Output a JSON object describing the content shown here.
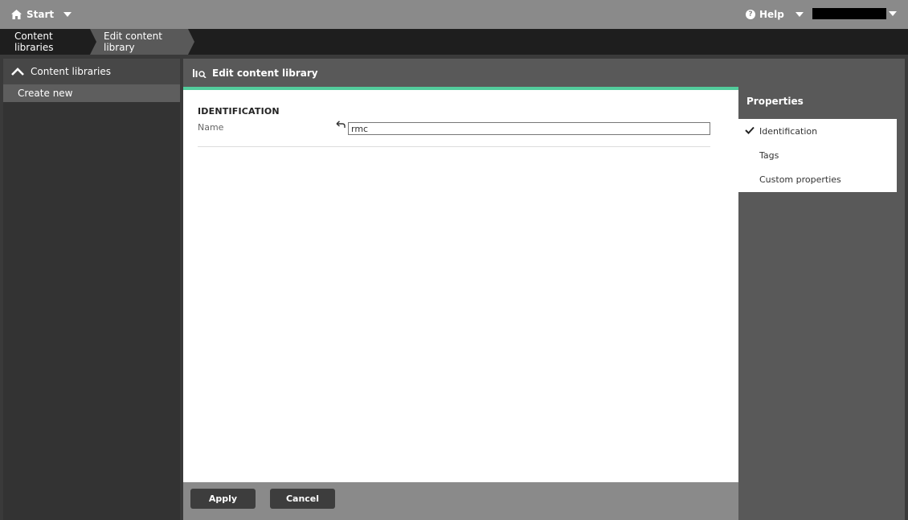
{
  "topbar": {
    "start_label": "Start",
    "help_label": "Help"
  },
  "breadcrumb": {
    "items": [
      "Content libraries",
      "Edit content library"
    ]
  },
  "sidebar": {
    "header_label": "Content libraries",
    "items": [
      {
        "label": "Create new"
      }
    ]
  },
  "main": {
    "title": "Edit content library",
    "section_title": "IDENTIFICATION",
    "name_label": "Name",
    "name_value": "rmc",
    "apply_label": "Apply",
    "cancel_label": "Cancel"
  },
  "properties": {
    "title": "Properties",
    "items": [
      {
        "label": "Identification",
        "checked": true
      },
      {
        "label": "Tags",
        "checked": false
      },
      {
        "label": "Custom properties",
        "checked": false
      }
    ]
  },
  "colors": {
    "accent": "#52cc9c",
    "topbar": "#8a8a8a",
    "breadcrumb_bg": "#1e1e1e"
  }
}
